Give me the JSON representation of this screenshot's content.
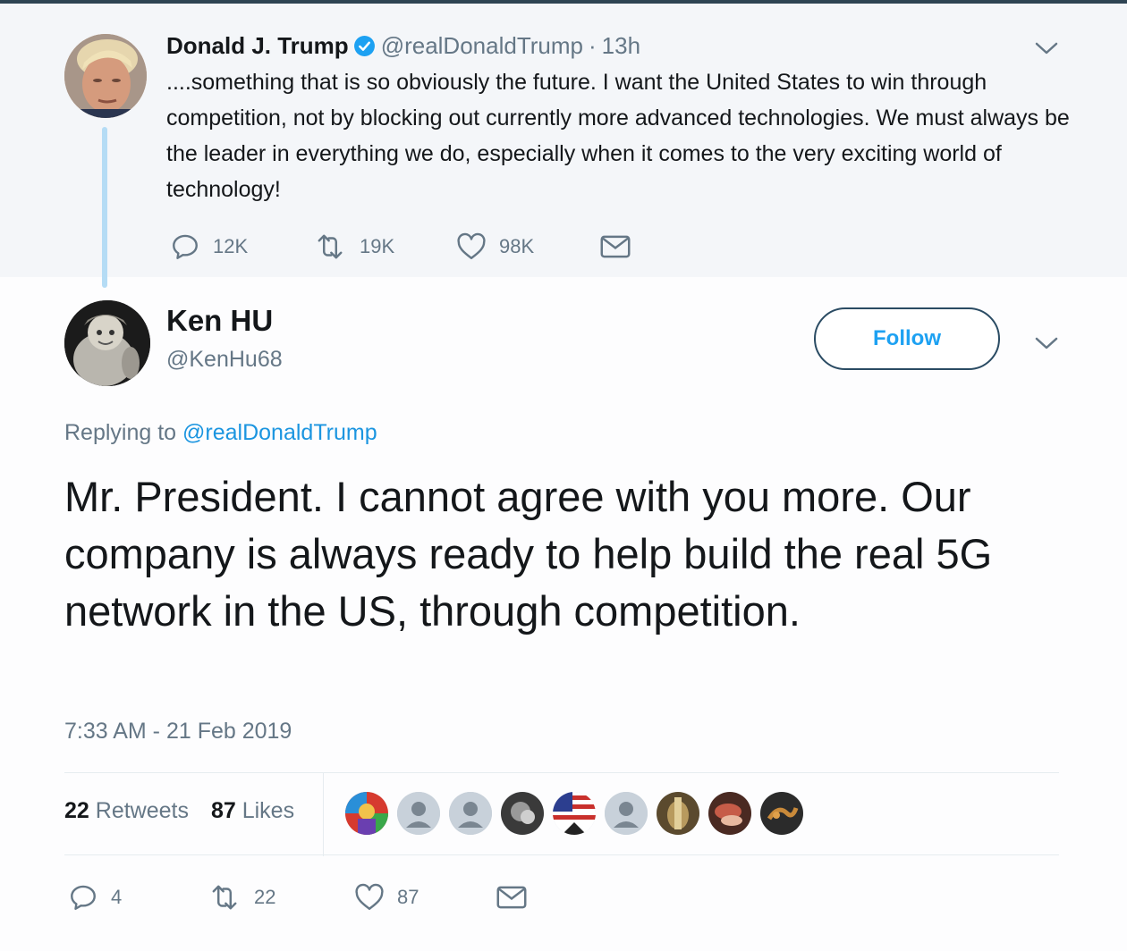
{
  "parent_tweet": {
    "name": "Donald J. Trump",
    "handle": "@realDonaldTrump",
    "time": "13h",
    "separator": "·",
    "text": "....something that is so obviously the future. I want the United States to win through competition, not by blocking out currently more advanced technologies. We must always be the leader in everything we do, especially when it comes to the very exciting world of technology!",
    "actions": {
      "replies": "12K",
      "retweets": "19K",
      "likes": "98K"
    }
  },
  "reply_tweet": {
    "name": "Ken HU",
    "handle": "@KenHu68",
    "follow_label": "Follow",
    "replying_prefix": "Replying to",
    "replying_to": "@realDonaldTrump",
    "text": "Mr. President. I cannot agree with you more. Our company is always ready to help build the real 5G network in the US, through competition.",
    "timestamp": "7:33 AM - 21 Feb 2019",
    "stats": {
      "retweets_count": "22",
      "retweets_label": "Retweets",
      "likes_count": "87",
      "likes_label": "Likes"
    },
    "liker_avatars": [
      "colorful-avatar",
      "default-avatar",
      "default-avatar",
      "grey-portrait-avatar",
      "flag-avatar",
      "default-avatar",
      "brown-photo-avatar",
      "red-photo-avatar",
      "dark-photo-avatar"
    ],
    "actions": {
      "replies": "4",
      "retweets": "22",
      "likes": "87"
    }
  },
  "colors": {
    "accent": "#1da1f2",
    "link": "#1b95e0",
    "muted": "#657786",
    "thread_line": "#b5dcf5"
  }
}
